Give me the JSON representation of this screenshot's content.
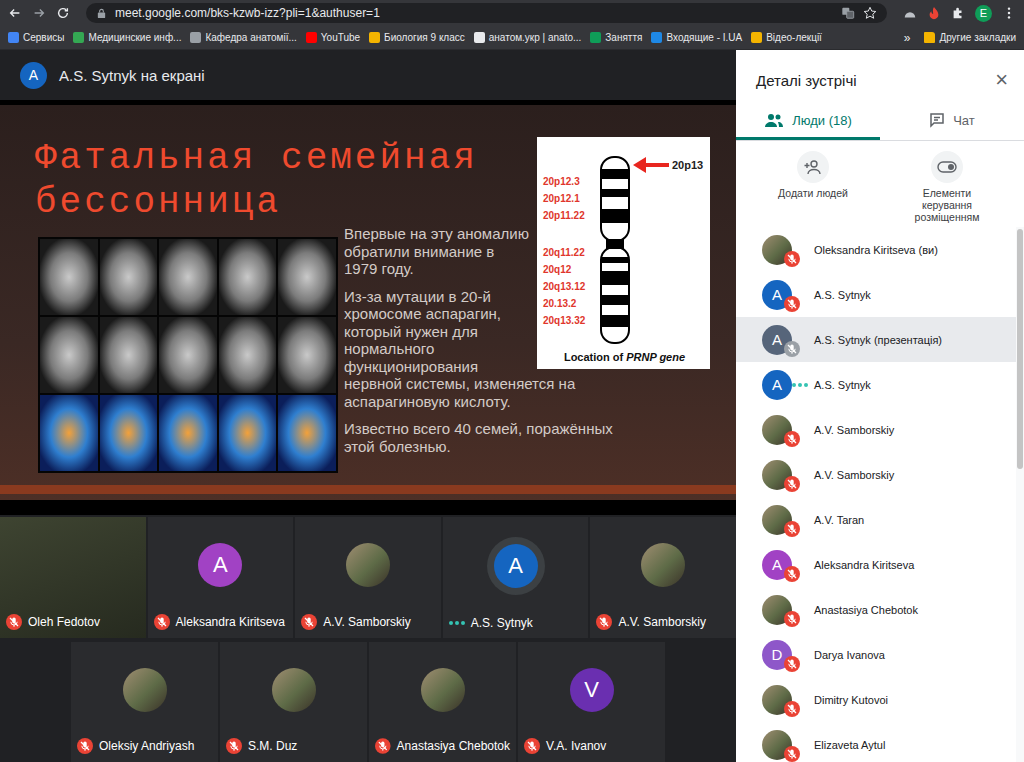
{
  "browser": {
    "url": "meet.google.com/bks-kzwb-izz?pli=1&authuser=1",
    "profile": "E",
    "bookmarks": [
      {
        "label": "Сервисы",
        "color": "#4285f4"
      },
      {
        "label": "Медицинские инф...",
        "color": "#34a853"
      },
      {
        "label": "Кафедра анатомії...",
        "color": "#9aa0a6"
      },
      {
        "label": "YouTube",
        "color": "#ff0000"
      },
      {
        "label": "Биология 9 класс",
        "color": "#f4b400"
      },
      {
        "label": "анатом.укр | anato...",
        "color": "#e8eaed"
      },
      {
        "label": "Заняття",
        "color": "#0f9d58"
      },
      {
        "label": "Входящие - I.UA",
        "color": "#1e88e5"
      },
      {
        "label": "Відео-лекції",
        "color": "#f4b400"
      }
    ],
    "more": "»",
    "other": {
      "label": "Другие закладки",
      "color": "#f4b400"
    }
  },
  "presenter": {
    "initial": "A",
    "color": "#1565c0",
    "label": "A.S. Sytnyk на екрані"
  },
  "slide": {
    "title": "Фатальная семейная бессонница",
    "paragraphs": [
      "Впервые на эту аномалию обратили внимание в 1979 году.",
      "Из-за мутации в 20-й хромосоме аспарагин, который нужен для нормального функционирования нервной системы, изменяется на аспарагиновую кислоту.",
      "Известно всего 40 семей, поражённых этой болезнью."
    ],
    "figure": {
      "marker": "20p13",
      "bands": [
        {
          "label": "20p12.3",
          "arm": "p"
        },
        {
          "label": "20p12.1",
          "arm": "p"
        },
        {
          "label": "20p11.22",
          "arm": "p"
        },
        {
          "label": "20q11.22",
          "arm": "q"
        },
        {
          "label": "20q12",
          "arm": "q"
        },
        {
          "label": "20q13.12",
          "arm": "q"
        },
        {
          "label": "20.13.2",
          "arm": "q"
        },
        {
          "label": "20q13.32",
          "arm": "q"
        }
      ],
      "caption": "Location of",
      "gene": "PRNP gene"
    }
  },
  "tile_rows": [
    [
      {
        "name": "Oleh Fedotov",
        "kind": "video",
        "muted": true,
        "speaking": false
      },
      {
        "name": "Aleksandra Kiritseva",
        "kind": "letter",
        "initial": "A",
        "color": "#a142c4",
        "muted": true,
        "speaking": false
      },
      {
        "name": "A.V. Samborskiy",
        "kind": "photo",
        "muted": true,
        "speaking": false
      },
      {
        "name": "A.S. Sytnyk",
        "kind": "letter",
        "initial": "A",
        "color": "#1565c0",
        "muted": false,
        "speaking": true
      },
      {
        "name": "A.V. Samborskiy",
        "kind": "photo",
        "muted": true,
        "speaking": false
      }
    ],
    [
      {
        "name": "Oleksiy Andriyash",
        "kind": "photo",
        "muted": true,
        "speaking": false
      },
      {
        "name": "S.M. Duz",
        "kind": "photo",
        "muted": true,
        "speaking": false
      },
      {
        "name": "Anastasiya Chebotok",
        "kind": "photo",
        "muted": true,
        "speaking": false
      },
      {
        "name": "V.A. Ivanov",
        "kind": "letter",
        "initial": "V",
        "color": "#6a2fb0",
        "muted": true,
        "speaking": false
      }
    ]
  ],
  "panel": {
    "title": "Деталі зустрічі",
    "close": "×",
    "tabs": [
      {
        "label": "Люди (18)",
        "kind": "people",
        "selected": true
      },
      {
        "label": "Чат",
        "kind": "chat",
        "selected": false
      }
    ],
    "actions": [
      {
        "label": "Додати людей",
        "kind": "add"
      },
      {
        "label": "Елементи керування розміщенням",
        "kind": "layout"
      }
    ],
    "people": [
      {
        "name": "Oleksandra Kiritseva (ви)",
        "kind": "photo",
        "mic": "muted",
        "selected": false
      },
      {
        "name": "A.S. Sytnyk",
        "kind": "letter",
        "initial": "A",
        "color": "#1565c0",
        "mic": "muted",
        "selected": false
      },
      {
        "name": "A.S. Sytnyk (презентація)",
        "kind": "letter",
        "initial": "A",
        "color": "#56657a",
        "mic": "presenting",
        "selected": true
      },
      {
        "name": "A.S. Sytnyk",
        "kind": "letter",
        "initial": "A",
        "color": "#1565c0",
        "mic": "speaking",
        "selected": false
      },
      {
        "name": "A.V. Samborskiy",
        "kind": "photo",
        "mic": "muted",
        "selected": false
      },
      {
        "name": "A.V. Samborskiy",
        "kind": "photo",
        "mic": "muted",
        "selected": false
      },
      {
        "name": "A.V. Taran",
        "kind": "photo",
        "mic": "muted",
        "selected": false
      },
      {
        "name": "Aleksandra Kiritseva",
        "kind": "letter",
        "initial": "A",
        "color": "#a142c4",
        "mic": "muted",
        "selected": false
      },
      {
        "name": "Anastasiya Chebotok",
        "kind": "photo",
        "mic": "muted",
        "selected": false
      },
      {
        "name": "Darya Ivanova",
        "kind": "letter",
        "initial": "D",
        "color": "#8e57c9",
        "mic": "muted",
        "selected": false
      },
      {
        "name": "Dimitry Kutovoi",
        "kind": "photo",
        "mic": "muted",
        "selected": false
      },
      {
        "name": "Elizaveta Aytul",
        "kind": "photo",
        "mic": "muted",
        "selected": false
      }
    ]
  }
}
